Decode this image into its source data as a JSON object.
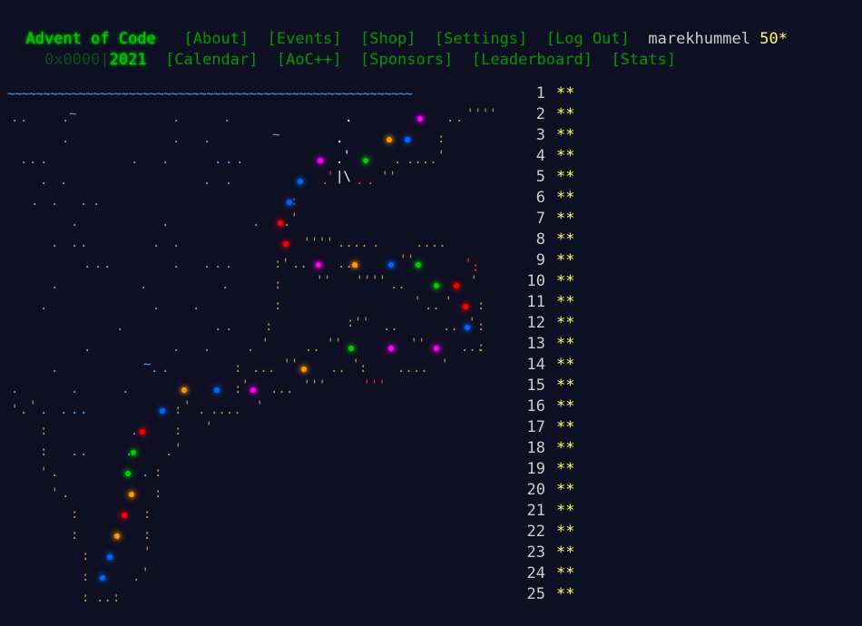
{
  "header": {
    "title": "Advent of Code",
    "nav_main": [
      "[About]",
      "[Events]",
      "[Shop]",
      "[Settings]",
      "[Log Out]"
    ],
    "user": "marekhummel",
    "star_count": "50*",
    "year_prefix": "0x0000|",
    "year": "2021",
    "nav_sub": [
      "[Calendar]",
      "[AoC++]",
      "[Sponsors]",
      "[Leaderboard]",
      "[Stats]"
    ]
  },
  "calendar": {
    "wave": "~~~~~~~~~~~~~~~~~~~~~~~~~~~~~~~~~~~~~~~~~~~~~~~~~~~~~~~~~",
    "days": [
      {
        "day": "1",
        "stars": "**"
      },
      {
        "day": "2",
        "stars": "**"
      },
      {
        "day": "3",
        "stars": "**"
      },
      {
        "day": "4",
        "stars": "**"
      },
      {
        "day": "5",
        "stars": "**"
      },
      {
        "day": "6",
        "stars": "**"
      },
      {
        "day": "7",
        "stars": "**"
      },
      {
        "day": "8",
        "stars": "**"
      },
      {
        "day": "9",
        "stars": "**"
      },
      {
        "day": "10",
        "stars": "**"
      },
      {
        "day": "11",
        "stars": "**"
      },
      {
        "day": "12",
        "stars": "**"
      },
      {
        "day": "13",
        "stars": "**"
      },
      {
        "day": "14",
        "stars": "**"
      },
      {
        "day": "15",
        "stars": "**"
      },
      {
        "day": "16",
        "stars": "**"
      },
      {
        "day": "17",
        "stars": "**"
      },
      {
        "day": "18",
        "stars": "**"
      },
      {
        "day": "19",
        "stars": "**"
      },
      {
        "day": "20",
        "stars": "**"
      },
      {
        "day": "21",
        "stars": "**"
      },
      {
        "day": "22",
        "stars": "**"
      },
      {
        "day": "23",
        "stars": "**"
      },
      {
        "day": "24",
        "stars": "**"
      },
      {
        "day": "25",
        "stars": "**"
      }
    ]
  },
  "colors": {
    "background": "#0f0f23",
    "logo": "#00cc00",
    "nav": "#009900",
    "star": "#ffff66",
    "ocean": "#5c9ee6",
    "lights": [
      "#ff00ff",
      "#ff9900",
      "#0066ff",
      "#00cc00",
      "#ff0000"
    ]
  }
}
